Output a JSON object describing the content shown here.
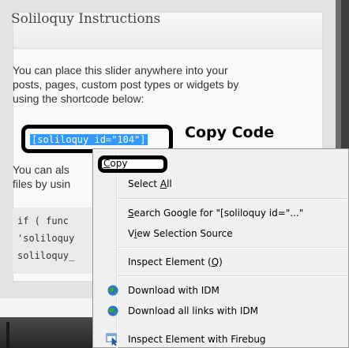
{
  "metabox": {
    "title": "Soliloquy Instructions",
    "paragraph1_lines": [
      "You can place this slider anywhere into your",
      "posts, pages, custom post types or widgets by",
      "using the shortcode below:"
    ],
    "shortcode": "[soliloquy id=\"104\"]",
    "copy_code_label": "Copy Code",
    "paragraph2_lines": [
      "You can als",
      "files by usin"
    ],
    "code_lines": [
      "if ( func",
      "'soliloquy",
      "soliloquy_"
    ]
  },
  "context_menu": {
    "items": [
      {
        "label": "Copy",
        "accesskey_index": 0,
        "icon": null
      },
      {
        "label": "Select All",
        "accesskey_index": 7,
        "icon": null
      },
      {
        "label": "Search Google for \"[soliloquy id=\"...\"",
        "accesskey_index": 0,
        "icon": null
      },
      {
        "label": "View Selection Source",
        "accesskey_index": 1,
        "icon": null
      },
      {
        "label": "Inspect Element (Q)",
        "accesskey_index": 17,
        "icon": null
      },
      {
        "label": "Download with IDM",
        "icon": "idm-globe-icon"
      },
      {
        "label": "Download all links with IDM",
        "icon": "idm-globe-icon"
      },
      {
        "label": "Inspect Element with Firebug",
        "icon": "firebug-inspect-icon"
      }
    ]
  },
  "colors": {
    "selection": "#3399ff",
    "menu_bg": "#f0f0f0",
    "idm_globe_blue": "#2d74c9",
    "idm_arrow_green": "#3aa53a"
  }
}
